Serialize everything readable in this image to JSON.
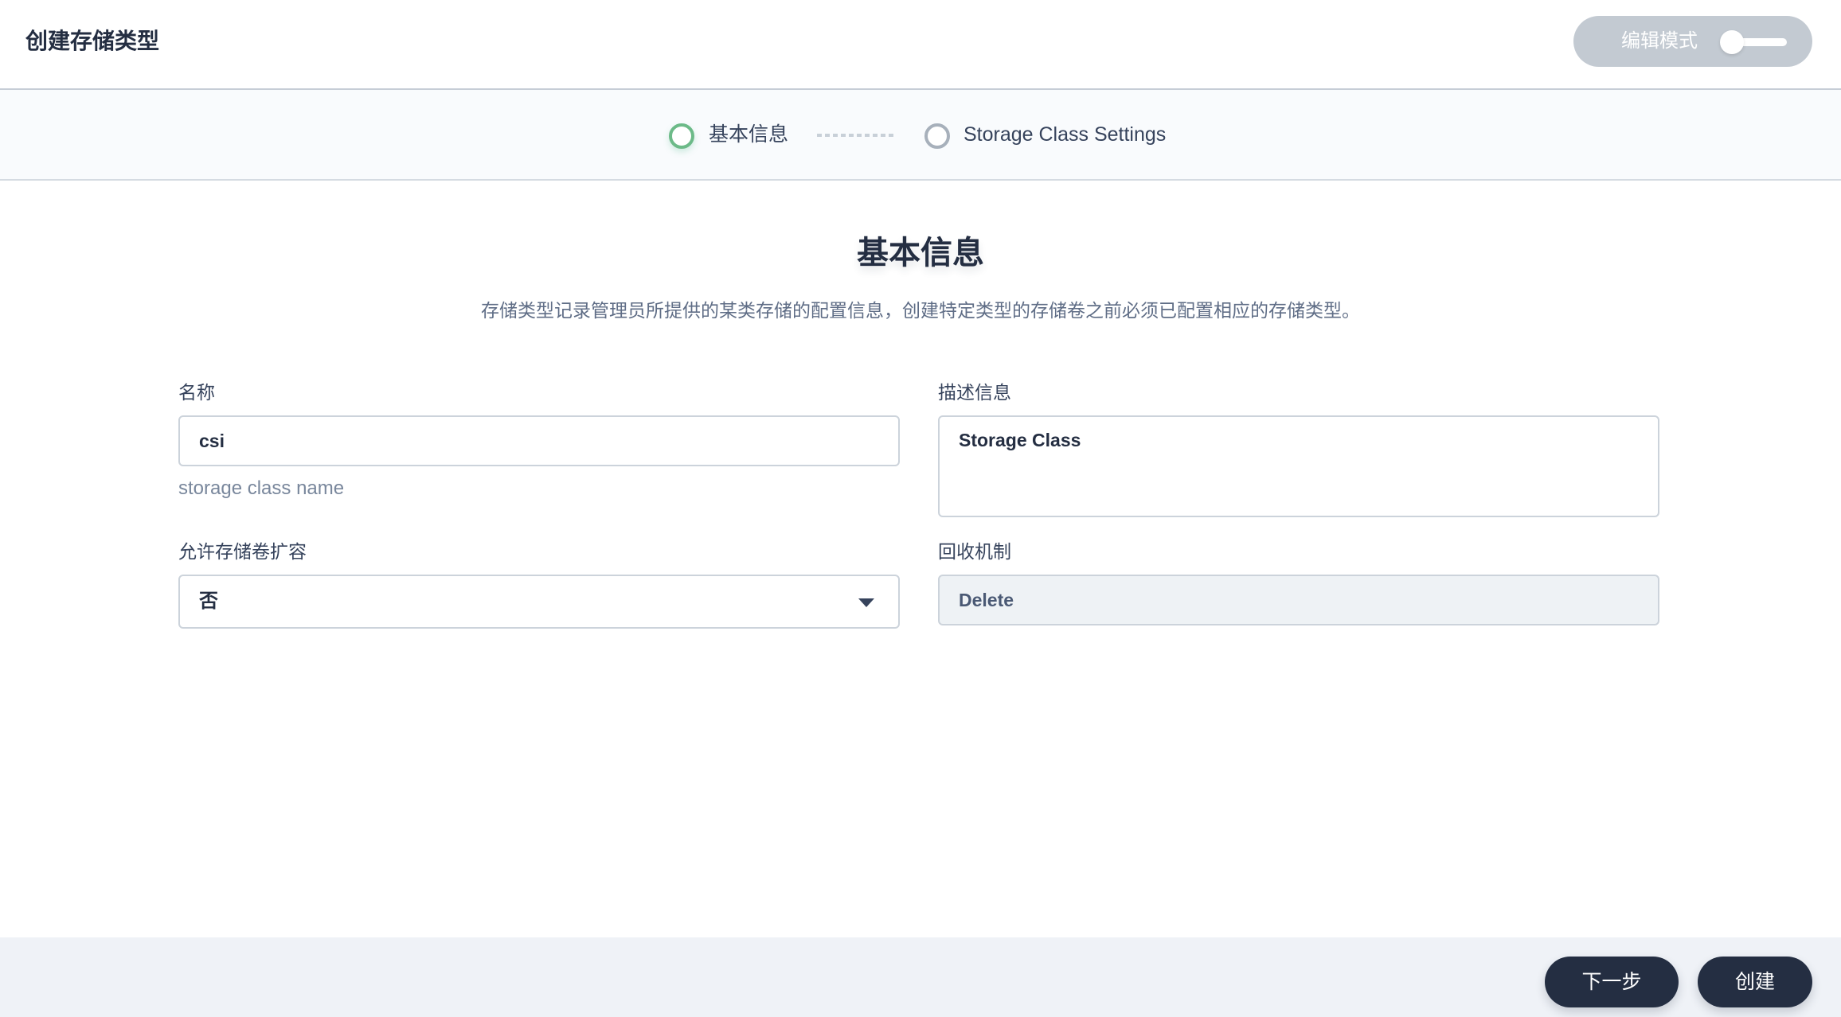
{
  "header": {
    "title": "创建存储类型",
    "edit_mode": {
      "label": "编辑模式",
      "enabled": false
    }
  },
  "steps": [
    {
      "label": "基本信息",
      "state": "active"
    },
    {
      "label": "Storage Class Settings",
      "state": "inactive"
    }
  ],
  "section": {
    "title": "基本信息",
    "description": "存储类型记录管理员所提供的某类存储的配置信息，创建特定类型的存储卷之前必须已配置相应的存储类型。"
  },
  "form": {
    "name": {
      "label": "名称",
      "value": "csi",
      "hint": "storage class name"
    },
    "description": {
      "label": "描述信息",
      "value": "Storage Class"
    },
    "allow_expansion": {
      "label": "允许存储卷扩容",
      "selected": "否"
    },
    "reclaim_policy": {
      "label": "回收机制",
      "value": "Delete"
    }
  },
  "footer": {
    "next_label": "下一步",
    "create_label": "创建"
  },
  "colors": {
    "primary_dark": "#242e42",
    "active_step": "#6cba88",
    "inactive_step": "#a7b0bb",
    "toggle_bg": "#c3cad2"
  }
}
